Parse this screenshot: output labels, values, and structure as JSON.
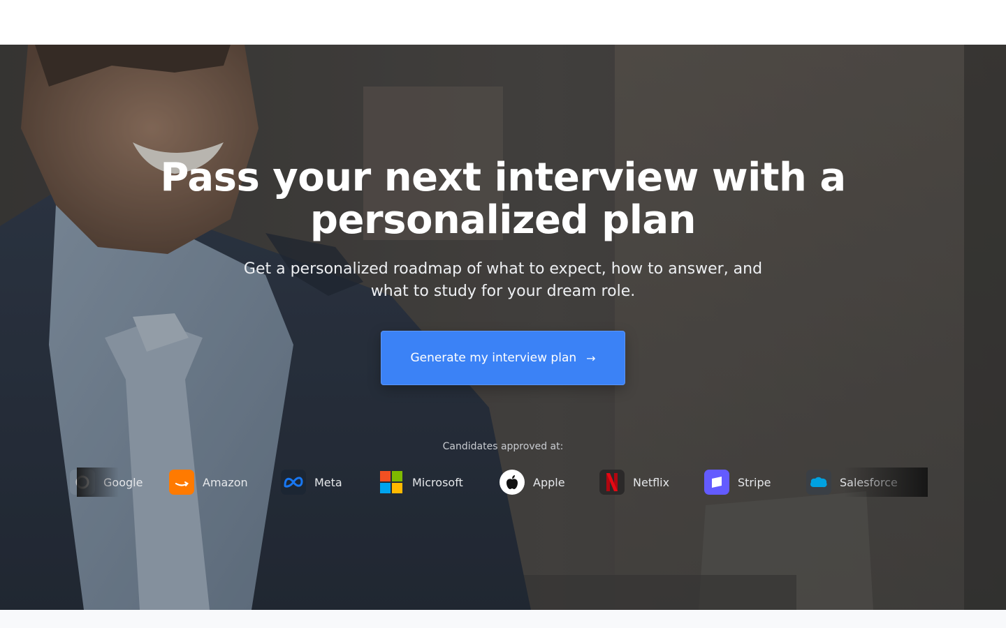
{
  "hero": {
    "title": "Pass your next interview with a personalized plan",
    "subtitle": "Get a personalized roadmap of what to expect, how to answer, and what to study for your dream role.",
    "cta_label": "Generate my interview plan",
    "cta_icon": "arrow-right-icon",
    "approved_label": "Candidates approved at:"
  },
  "companies": [
    {
      "name": "Google",
      "icon": "google-logo-icon"
    },
    {
      "name": "Amazon",
      "icon": "amazon-logo-icon",
      "color": "#ff7a00"
    },
    {
      "name": "Meta",
      "icon": "meta-logo-icon",
      "color": "#1877f2"
    },
    {
      "name": "Microsoft",
      "icon": "microsoft-logo-icon"
    },
    {
      "name": "Apple",
      "icon": "apple-logo-icon"
    },
    {
      "name": "Netflix",
      "icon": "netflix-logo-icon",
      "color": "#e50914"
    },
    {
      "name": "Stripe",
      "icon": "stripe-logo-icon",
      "color": "#635bff"
    },
    {
      "name": "Salesforce",
      "icon": "salesforce-logo-icon",
      "color": "#00a1e0"
    }
  ],
  "colors": {
    "accent": "#3b82f6",
    "hero_text": "#ffffff"
  }
}
